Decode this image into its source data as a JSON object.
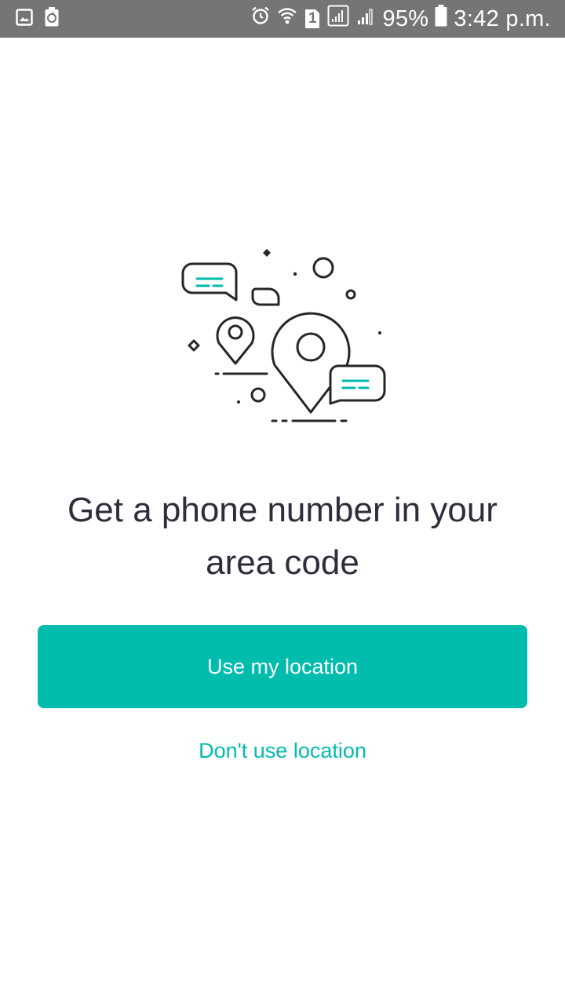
{
  "status_bar": {
    "battery_percent": "95%",
    "time": "3:42 p.m.",
    "sim_slot": "1",
    "icons": [
      "image-icon",
      "battery-saver-icon",
      "alarm-icon",
      "wifi-icon",
      "sim-icon",
      "signal-icon",
      "signal-2-icon",
      "battery-icon"
    ]
  },
  "main": {
    "illustration": "location-pins-chat-illustration",
    "headline": "Get a phone number in your area code",
    "primary_button_label": "Use my location",
    "secondary_link_label": "Don't use location"
  },
  "colors": {
    "accent": "#00bcad",
    "status_bar_bg": "#757575",
    "headline_text": "#2c2e3a",
    "background": "#ffffff"
  }
}
